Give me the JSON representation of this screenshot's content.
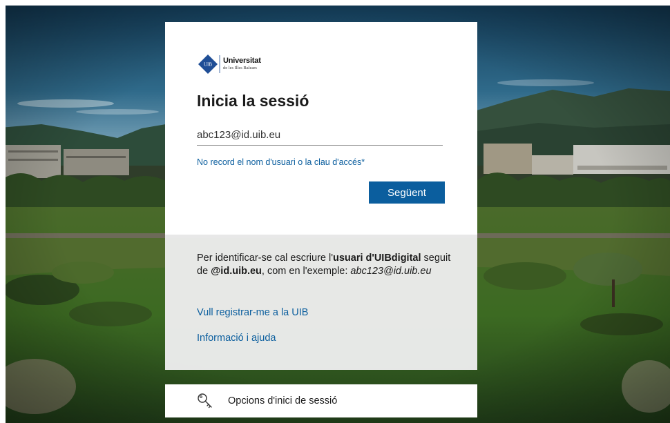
{
  "logo": {
    "name": "Universitat",
    "subtitle": "de les Illes Balears",
    "badge": "UIB"
  },
  "signin": {
    "title": "Inicia la sessió",
    "email_value": "abc123@id.uib.eu",
    "forgot_link": "No record el nom d'usuari o la clau d'accés*",
    "next_button": "Següent"
  },
  "info": {
    "text_part1": "Per identificar-se cal escriure l'",
    "text_bold1": "usuari d'UIBdigital",
    "text_part2": " seguit de ",
    "text_bold2": "@id.uib.eu",
    "text_part3": ", com en l'exemple: ",
    "text_italic": "abc123@id.uib.eu",
    "register_link": "Vull registrar-me a la UIB",
    "help_link": "Informació i ajuda"
  },
  "options": {
    "label": "Opcions d'inici de sessió",
    "icon": "key-icon"
  },
  "colors": {
    "accent": "#0b5e9e",
    "link": "#0b5e9e",
    "logo_blue": "#1f4e96"
  }
}
